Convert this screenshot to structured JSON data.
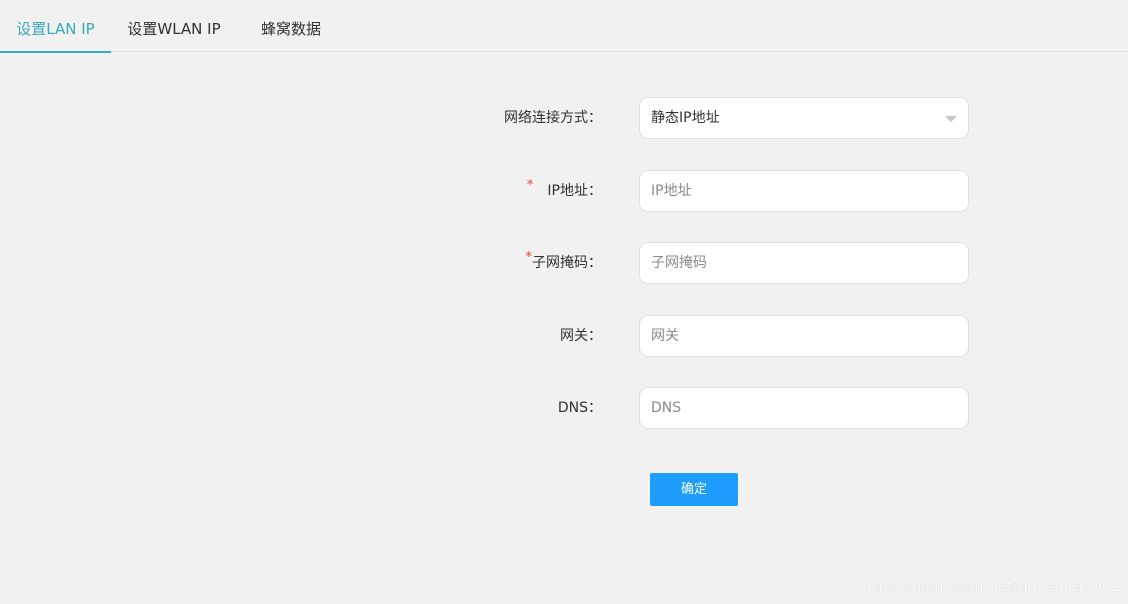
{
  "tabs": [
    {
      "label": "设置LAN IP",
      "active": true
    },
    {
      "label": "设置WLAN IP",
      "active": false
    },
    {
      "label": "蜂窝数据",
      "active": false
    }
  ],
  "form": {
    "connection_mode": {
      "label": "网络连接方式：",
      "value": "静态IP地址"
    },
    "ip": {
      "required_mark": "*",
      "label": "IP地址：",
      "value": "",
      "placeholder": "IP地址"
    },
    "mask": {
      "required_mark": "*",
      "label": "子网掩码：",
      "value": "",
      "placeholder": "子网掩码"
    },
    "gateway": {
      "label": "网关：",
      "value": "",
      "placeholder": "网关"
    },
    "dns": {
      "label": "DNS：",
      "value": "",
      "placeholder": "DNS"
    },
    "submit_label": "确定"
  },
  "watermark": "https://blog.csdn.net/qq_20495901",
  "colors": {
    "accent": "#3aa9b9",
    "primary_button": "#1e9fff",
    "required": "#f04134",
    "background": "#f1f1f1"
  },
  "icons": {
    "select_caret": "caret-down-icon"
  }
}
